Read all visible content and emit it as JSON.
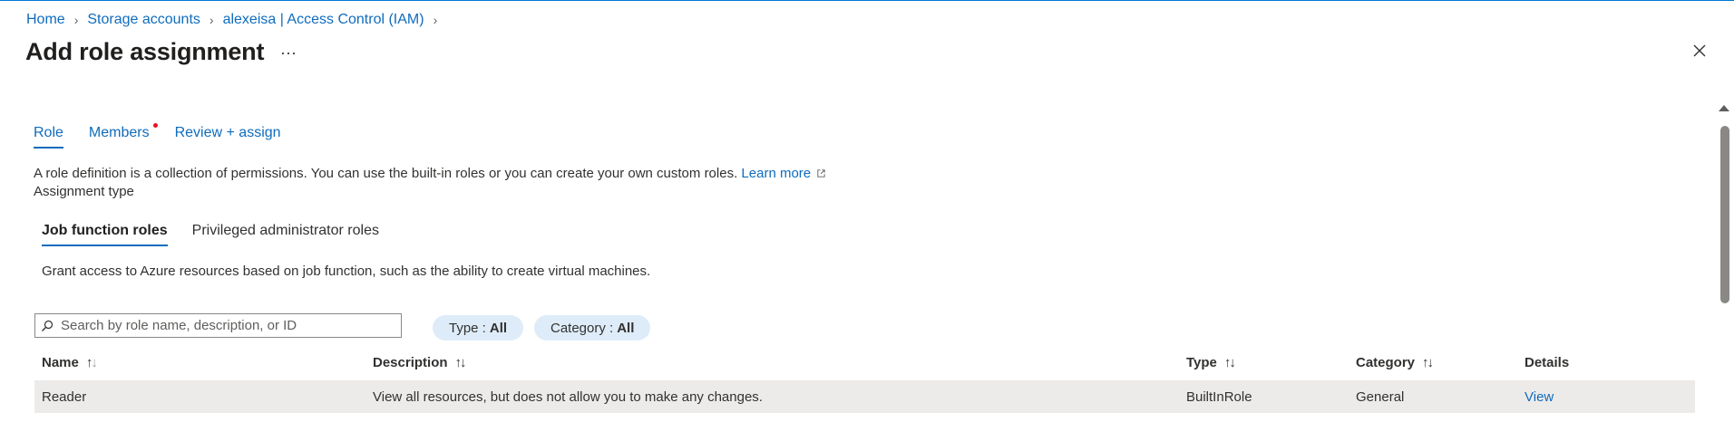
{
  "breadcrumb": {
    "items": [
      "Home",
      "Storage accounts",
      "alexeisa | Access Control (IAM)"
    ]
  },
  "page": {
    "title": "Add role assignment",
    "more_label": "···"
  },
  "tabs": [
    {
      "label": "Role",
      "active": true
    },
    {
      "label": "Members",
      "active": false,
      "required_dot": true
    },
    {
      "label": "Review + assign",
      "active": false
    }
  ],
  "description": {
    "text": "A role definition is a collection of permissions. You can use the built-in roles or you can create your own custom roles.",
    "link": "Learn more"
  },
  "assignment_type_label": "Assignment type",
  "subtabs": [
    {
      "label": "Job function roles",
      "active": true
    },
    {
      "label": "Privileged administrator roles",
      "active": false
    }
  ],
  "grant_text": "Grant access to Azure resources based on job function, such as the ability to create virtual machines.",
  "search": {
    "placeholder": "Search by role name, description, or ID",
    "value": ""
  },
  "filters": [
    {
      "label": "Type :",
      "value": "All"
    },
    {
      "label": "Category :",
      "value": "All"
    }
  ],
  "table": {
    "columns": [
      "Name",
      "Description",
      "Type",
      "Category",
      "Details"
    ],
    "rows": [
      {
        "name": "Reader",
        "description": "View all resources, but does not allow you to make any changes.",
        "type": "BuiltInRole",
        "category": "General",
        "details": "View"
      }
    ]
  },
  "colors": {
    "accent": "#0f6cbd",
    "selected_row": "#edebe9",
    "pill_bg": "#deecf9",
    "required_dot": "#e81123"
  }
}
